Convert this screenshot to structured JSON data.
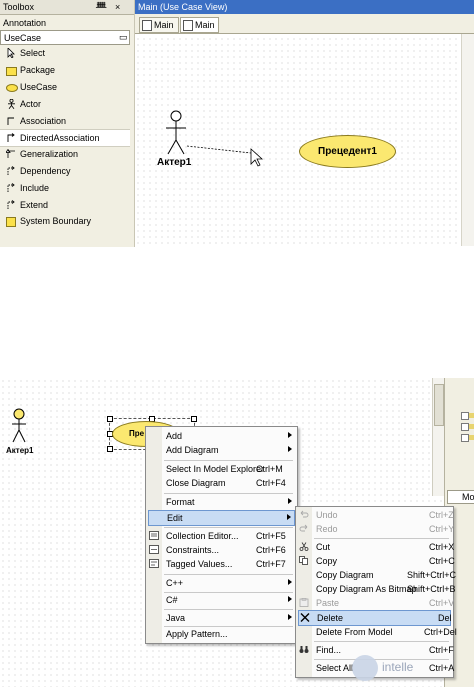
{
  "toolbox": {
    "title": "Toolbox",
    "pin_glyph": "ᚙ",
    "close_glyph": "×",
    "sections": {
      "annotation": "Annotation",
      "usecase": "UseCase",
      "usecase_toggle": "▭"
    },
    "items": [
      {
        "label": "Select",
        "icon": "pointer-icon"
      },
      {
        "label": "Package",
        "icon": "package-icon"
      },
      {
        "label": "UseCase",
        "icon": "usecase-icon"
      },
      {
        "label": "Actor",
        "icon": "actor-icon"
      },
      {
        "label": "Association",
        "icon": "association-icon"
      },
      {
        "label": "DirectedAssociation",
        "icon": "directed-association-icon"
      },
      {
        "label": "Generalization",
        "icon": "generalization-icon"
      },
      {
        "label": "Dependency",
        "icon": "dependency-icon"
      },
      {
        "label": "Include",
        "icon": "include-icon"
      },
      {
        "label": "Extend",
        "icon": "extend-icon"
      },
      {
        "label": "System Boundary",
        "icon": "system-boundary-icon"
      }
    ],
    "selected_index": 5
  },
  "diagram_top": {
    "title": "Main (Use Case View)",
    "tabs": [
      "Main",
      "Main"
    ],
    "actor_label": "Актер1",
    "usecase_label": "Прецедент1"
  },
  "diagram_bottom": {
    "actor_label": "Актер1",
    "usecase_label_partial": "Пре",
    "right_tab_label": "Mod"
  },
  "context_menu": {
    "items": [
      {
        "label": "Add",
        "submenu": true
      },
      {
        "label": "Add Diagram",
        "submenu": true
      },
      {
        "label": "Select In Model Explorer",
        "shortcut": "Ctrl+M"
      },
      {
        "label": "Close Diagram",
        "shortcut": "Ctrl+F4"
      },
      {
        "label": "Format",
        "submenu": true
      },
      {
        "label": "Edit",
        "submenu": true,
        "highlighted": true
      },
      {
        "label": "Collection Editor...",
        "shortcut": "Ctrl+F5"
      },
      {
        "label": "Constraints...",
        "shortcut": "Ctrl+F6"
      },
      {
        "label": "Tagged Values...",
        "shortcut": "Ctrl+F7"
      },
      {
        "label": "C++",
        "submenu": true
      },
      {
        "label": "C#",
        "submenu": true
      },
      {
        "label": "Java",
        "submenu": true
      },
      {
        "label": "Apply Pattern..."
      }
    ]
  },
  "edit_submenu": {
    "items": [
      {
        "label": "Undo",
        "shortcut": "Ctrl+Z",
        "disabled": true
      },
      {
        "label": "Redo",
        "shortcut": "Ctrl+Y",
        "disabled": true
      },
      {
        "label": "Cut",
        "shortcut": "Ctrl+X"
      },
      {
        "label": "Copy",
        "shortcut": "Ctrl+C"
      },
      {
        "label": "Copy Diagram",
        "shortcut": "Shift+Ctrl+C"
      },
      {
        "label": "Copy Diagram As Bitmap",
        "shortcut": "Shift+Ctrl+B"
      },
      {
        "label": "Paste",
        "shortcut": "Ctrl+V",
        "disabled": true
      },
      {
        "label": "Delete",
        "shortcut": "Del",
        "highlighted": true
      },
      {
        "label": "Delete From Model",
        "shortcut": "Ctrl+Del"
      },
      {
        "label": "Find...",
        "shortcut": "Ctrl+F"
      },
      {
        "label": "Select All",
        "shortcut": "Ctrl+A"
      }
    ]
  },
  "watermark": {
    "text": "intelle"
  },
  "colors": {
    "usecase_fill": "#fbe870",
    "titlebar": "#3b6fc4",
    "menu_highlight": "#c8dcf4"
  }
}
